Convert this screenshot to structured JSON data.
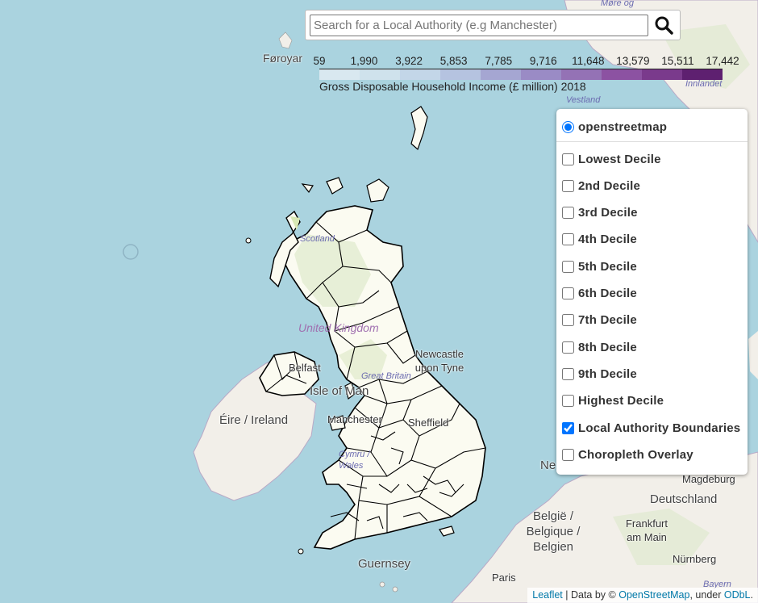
{
  "search": {
    "placeholder": "Search for a Local Authority (e.g Manchester)"
  },
  "legend": {
    "ticks": [
      "59",
      "1,990",
      "3,922",
      "5,853",
      "7,785",
      "9,716",
      "11,648",
      "13,579",
      "15,511",
      "17,442"
    ],
    "colors": [
      "#d9e8f0",
      "#cfe2ec",
      "#c3d6e8",
      "#b5c3e0",
      "#a5a6d2",
      "#9a8bc5",
      "#9472b5",
      "#8c52a2",
      "#7a3a8c",
      "#5e2070"
    ],
    "title": "Gross Disposable Household Income (£ million) 2018"
  },
  "layers": {
    "base": "openstreetmap",
    "overlays": [
      {
        "label": "Lowest Decile",
        "checked": false
      },
      {
        "label": "2nd Decile",
        "checked": false
      },
      {
        "label": "3rd Decile",
        "checked": false
      },
      {
        "label": "4th Decile",
        "checked": false
      },
      {
        "label": "5th Decile",
        "checked": false
      },
      {
        "label": "6th Decile",
        "checked": false
      },
      {
        "label": "7th Decile",
        "checked": false
      },
      {
        "label": "8th Decile",
        "checked": false
      },
      {
        "label": "9th Decile",
        "checked": false
      },
      {
        "label": "Highest Decile",
        "checked": false
      },
      {
        "label": "Local Authority Boundaries",
        "checked": true
      },
      {
        "label": "Choropleth Overlay",
        "checked": false
      }
    ]
  },
  "map_labels": {
    "faroe": "Føroyar",
    "norway_sea": "Møre og",
    "innlandet": "Innlandet",
    "vestland": "Vestland",
    "scotland": "Scotland",
    "uk": "United Kingdom",
    "newcastle": "Newcastle upon Tyne",
    "belfast": "Belfast",
    "isle_of_man": "Isle of Man",
    "ireland": "Éire / Ireland",
    "manchester": "Manchester",
    "sheffield": "Sheffield",
    "great_britain": "Great Britain",
    "cymru": "Cymru / Wales",
    "guernsey": "Guernsey",
    "paris": "Paris",
    "belgie": "België / Belgique / Belgien",
    "frankfurt": "Frankfurt am Main",
    "deutschland": "Deutschland",
    "magdeburg": "Magdeburg",
    "nurnberg": "Nürnberg",
    "bayern": "Bayern",
    "ne": "Ne"
  },
  "attribution": {
    "leaflet": "Leaflet",
    "sep1": " | Data by © ",
    "osm": "OpenStreetMap",
    "sep2": ", under ",
    "odbl": "ODbL",
    "end": "."
  },
  "colors": {
    "sea": "#aad3df",
    "land": "#f2efe9",
    "boundary": "#000000",
    "park": "#cdebb0"
  }
}
